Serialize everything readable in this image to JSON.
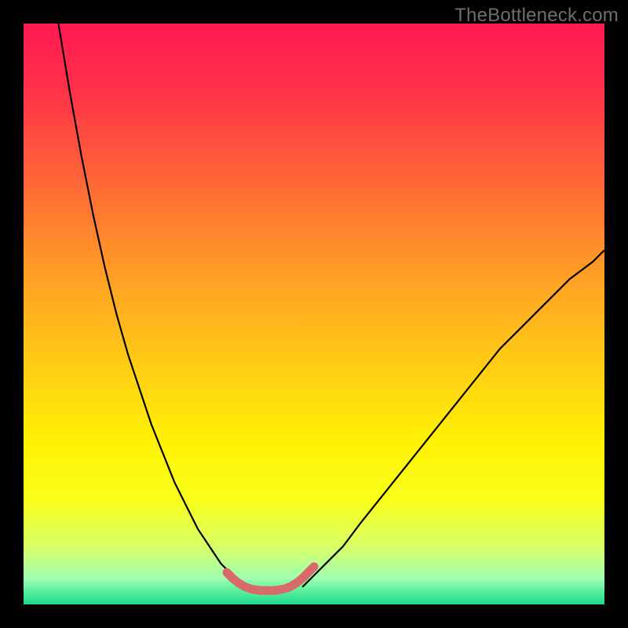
{
  "watermark": "TheBottleneck.com",
  "chart_data": {
    "type": "line",
    "title": "",
    "xlabel": "",
    "ylabel": "",
    "xlim": [
      0,
      100
    ],
    "ylim": [
      0,
      100
    ],
    "grid": false,
    "legend": false,
    "series": [
      {
        "name": "curve-left",
        "stroke": "#000000",
        "stroke_width": 2.2,
        "x": [
          6,
          8,
          10,
          12,
          14,
          16,
          18,
          20,
          22,
          24,
          26,
          28,
          30,
          32,
          34,
          36,
          38
        ],
        "values": [
          100,
          88,
          77,
          67,
          58,
          50,
          43,
          37,
          31,
          26,
          21,
          17,
          13,
          10,
          7,
          5,
          3
        ]
      },
      {
        "name": "curve-right",
        "stroke": "#000000",
        "stroke_width": 2.2,
        "x": [
          48,
          50,
          52,
          55,
          58,
          62,
          66,
          70,
          74,
          78,
          82,
          86,
          90,
          94,
          98,
          100
        ],
        "values": [
          3,
          5,
          7,
          10,
          14,
          19,
          24,
          29,
          34,
          39,
          44,
          48,
          52,
          56,
          59,
          61
        ]
      },
      {
        "name": "valley-marker",
        "stroke": "#d86a6a",
        "stroke_width": 11,
        "linecap": "round",
        "x": [
          35,
          36,
          37,
          38,
          39,
          40,
          41,
          42,
          43,
          44,
          45,
          46,
          47,
          48,
          49,
          50
        ],
        "values": [
          5.5,
          4.5,
          3.7,
          3.1,
          2.7,
          2.5,
          2.4,
          2.4,
          2.4,
          2.5,
          2.7,
          3.1,
          3.7,
          4.5,
          5.5,
          6.5
        ]
      }
    ],
    "background_gradient": {
      "type": "vertical",
      "stops": [
        {
          "offset": 0.0,
          "color": "#ff1a52"
        },
        {
          "offset": 0.12,
          "color": "#ff3348"
        },
        {
          "offset": 0.28,
          "color": "#ff6a36"
        },
        {
          "offset": 0.45,
          "color": "#ffa423"
        },
        {
          "offset": 0.6,
          "color": "#ffd013"
        },
        {
          "offset": 0.72,
          "color": "#fff205"
        },
        {
          "offset": 0.82,
          "color": "#f8ff1a"
        },
        {
          "offset": 0.9,
          "color": "#d8ff66"
        },
        {
          "offset": 0.955,
          "color": "#9fffb0"
        },
        {
          "offset": 0.985,
          "color": "#44e89a"
        },
        {
          "offset": 1.0,
          "color": "#1fd88a"
        }
      ]
    }
  }
}
